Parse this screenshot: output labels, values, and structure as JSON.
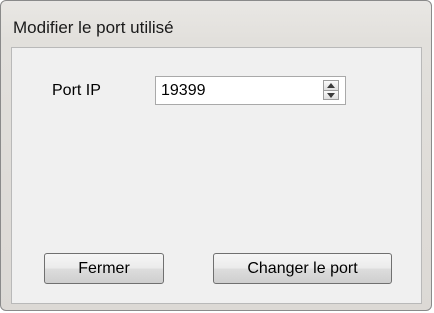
{
  "window": {
    "title": "Modifier le port utilisé"
  },
  "form": {
    "port_label": "Port IP",
    "port_value": "19399"
  },
  "buttons": {
    "close_label": "Fermer",
    "change_label": "Changer le port"
  },
  "icons": {
    "spin_up": "spin-up-icon",
    "spin_down": "spin-down-icon"
  }
}
